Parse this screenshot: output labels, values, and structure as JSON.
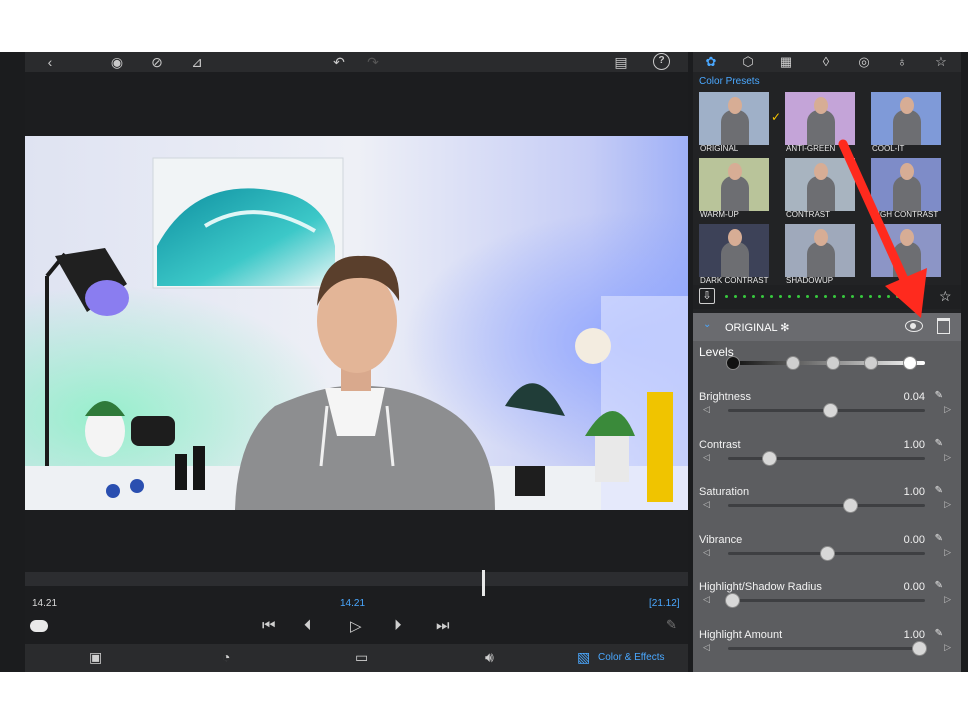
{
  "toolbar": {
    "back": "‹",
    "view1": "◉",
    "view2": "⊘",
    "view3": "⊿",
    "undo": "↶",
    "redo": "↷",
    "clipboard": "▤",
    "help": "?"
  },
  "player": {
    "time_left": "14.21",
    "time_center": "14.21",
    "time_right": "[21.12]"
  },
  "bottom_bar": {
    "color_effects_label": "Color & Effects"
  },
  "right_panel": {
    "tabs": [
      "color-wheel-icon",
      "cube-icon",
      "grid-icon",
      "drop-icon",
      "spiral-icon",
      "bulb-icon",
      "star-icon"
    ],
    "presets_title": "Color Presets",
    "presets": [
      {
        "label": "ORIGINAL",
        "tint": "#9fb0c8",
        "selected": true
      },
      {
        "label": "ANTI-GREEN",
        "tint": "#c4a4d8",
        "selected": false
      },
      {
        "label": "COOL-IT",
        "tint": "#7f9ad8",
        "selected": false
      },
      {
        "label": "WARM-UP",
        "tint": "#b9c49a",
        "selected": false
      },
      {
        "label": "CONTRAST",
        "tint": "#a8b4c0",
        "selected": false
      },
      {
        "label": "HIGH CONTRAST",
        "tint": "#7e8cc8",
        "selected": false
      },
      {
        "label": "DARK CONTRAST",
        "tint": "#3d4258",
        "selected": false
      },
      {
        "label": "SHADOWUP",
        "tint": "#9fa9bb",
        "selected": false
      },
      {
        "label": "",
        "tint": "#8c95c6",
        "selected": false
      }
    ],
    "effect_title": "ORIGINAL ✻",
    "levels_label": "Levels",
    "levels_knobs": [
      0.0,
      0.31,
      0.52,
      0.72,
      0.92
    ],
    "sliders": [
      {
        "label": "Brightness",
        "value": "0.04",
        "position": 0.52
      },
      {
        "label": "Contrast",
        "value": "1.00",
        "position": 0.21
      },
      {
        "label": "Saturation",
        "value": "1.00",
        "position": 0.62
      },
      {
        "label": "Vibrance",
        "value": "0.00",
        "position": 0.5
      },
      {
        "label": "Highlight/Shadow Radius",
        "value": "0.00",
        "position": 0.02
      },
      {
        "label": "Highlight Amount",
        "value": "1.00",
        "position": 0.97
      }
    ]
  },
  "colors": {
    "accent": "#4aa8ff",
    "annotation_arrow": "#ff2a1e"
  }
}
